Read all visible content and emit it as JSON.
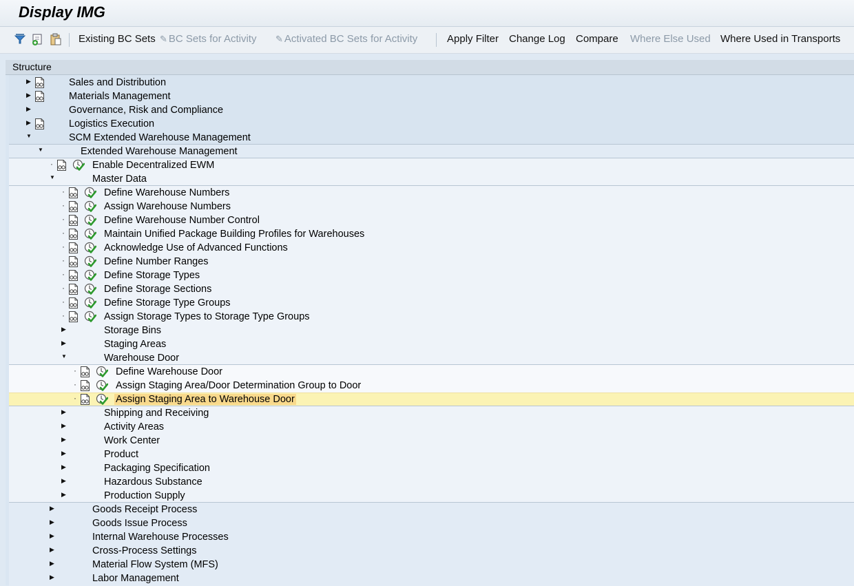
{
  "window": {
    "title": "Display IMG"
  },
  "toolbar": {
    "icons": [
      "filter-icon",
      "add-icon",
      "paste-icon"
    ],
    "buttons": [
      {
        "label": "Existing BC Sets",
        "enabled": true
      },
      {
        "label": "BC Sets for Activity",
        "enabled": false,
        "icon": "bc-set-icon"
      },
      {
        "label": "Activated BC Sets for Activity",
        "enabled": false,
        "icon": "bc-set-icon"
      },
      {
        "label": "Apply Filter",
        "enabled": true
      },
      {
        "label": "Change Log",
        "enabled": true
      },
      {
        "label": "Compare",
        "enabled": true
      },
      {
        "label": "Where Else Used",
        "enabled": false
      },
      {
        "label": "Where Used in Transports",
        "enabled": true
      }
    ]
  },
  "tree": {
    "header": "Structure",
    "selected_item": "Assign Staging Area to Warehouse Door",
    "rows": [
      {
        "label": "Sales and Distribution",
        "level": 1,
        "state": "collapsed",
        "doc": true,
        "exec": false
      },
      {
        "label": "Materials Management",
        "level": 1,
        "state": "collapsed",
        "doc": true,
        "exec": false
      },
      {
        "label": "Governance, Risk and Compliance",
        "level": 1,
        "state": "collapsed",
        "doc": false,
        "exec": false
      },
      {
        "label": "Logistics Execution",
        "level": 1,
        "state": "collapsed",
        "doc": true,
        "exec": false
      },
      {
        "label": "SCM Extended Warehouse Management",
        "level": 1,
        "state": "expanded",
        "doc": false,
        "exec": false
      },
      {
        "label": "Extended Warehouse Management",
        "level": 2,
        "state": "expanded",
        "doc": false,
        "exec": false
      },
      {
        "label": "Enable Decentralized EWM",
        "level": 3,
        "state": "leaf",
        "doc": true,
        "exec": true
      },
      {
        "label": "Master Data",
        "level": 3,
        "state": "expanded",
        "doc": false,
        "exec": false
      },
      {
        "label": "Define Warehouse Numbers",
        "level": 4,
        "state": "leaf",
        "doc": true,
        "exec": true
      },
      {
        "label": "Assign Warehouse Numbers",
        "level": 4,
        "state": "leaf",
        "doc": true,
        "exec": true
      },
      {
        "label": "Define Warehouse Number Control",
        "level": 4,
        "state": "leaf",
        "doc": true,
        "exec": true
      },
      {
        "label": "Maintain Unified Package Building Profiles for Warehouses",
        "level": 4,
        "state": "leaf",
        "doc": true,
        "exec": true
      },
      {
        "label": "Acknowledge Use of Advanced Functions",
        "level": 4,
        "state": "leaf",
        "doc": true,
        "exec": true
      },
      {
        "label": "Define Number Ranges",
        "level": 4,
        "state": "leaf",
        "doc": true,
        "exec": true
      },
      {
        "label": "Define Storage Types",
        "level": 4,
        "state": "leaf",
        "doc": true,
        "exec": true
      },
      {
        "label": "Define Storage Sections",
        "level": 4,
        "state": "leaf",
        "doc": true,
        "exec": true
      },
      {
        "label": "Define Storage Type Groups",
        "level": 4,
        "state": "leaf",
        "doc": true,
        "exec": true
      },
      {
        "label": "Assign Storage Types to Storage Type Groups",
        "level": 4,
        "state": "leaf",
        "doc": true,
        "exec": true
      },
      {
        "label": "Storage Bins",
        "level": 4,
        "state": "collapsed",
        "doc": false,
        "exec": false
      },
      {
        "label": "Staging Areas",
        "level": 4,
        "state": "collapsed",
        "doc": false,
        "exec": false
      },
      {
        "label": "Warehouse Door",
        "level": 4,
        "state": "expanded",
        "doc": false,
        "exec": false
      },
      {
        "label": "Define Warehouse Door",
        "level": 5,
        "state": "leaf",
        "doc": true,
        "exec": true
      },
      {
        "label": "Assign Staging Area/Door Determination Group to Door",
        "level": 5,
        "state": "leaf",
        "doc": true,
        "exec": true
      },
      {
        "label": "Assign Staging Area to Warehouse Door",
        "level": 5,
        "state": "leaf",
        "doc": true,
        "exec": true,
        "selected": true
      },
      {
        "label": "Shipping and Receiving",
        "level": 4,
        "state": "collapsed",
        "doc": false,
        "exec": false
      },
      {
        "label": "Activity Areas",
        "level": 4,
        "state": "collapsed",
        "doc": false,
        "exec": false
      },
      {
        "label": "Work Center",
        "level": 4,
        "state": "collapsed",
        "doc": false,
        "exec": false
      },
      {
        "label": "Product",
        "level": 4,
        "state": "collapsed",
        "doc": false,
        "exec": false
      },
      {
        "label": "Packaging Specification",
        "level": 4,
        "state": "collapsed",
        "doc": false,
        "exec": false
      },
      {
        "label": "Hazardous Substance",
        "level": 4,
        "state": "collapsed",
        "doc": false,
        "exec": false
      },
      {
        "label": "Production Supply",
        "level": 4,
        "state": "collapsed",
        "doc": false,
        "exec": false
      },
      {
        "label": "Goods Receipt Process",
        "level": 3,
        "state": "collapsed",
        "doc": false,
        "exec": false
      },
      {
        "label": "Goods Issue Process",
        "level": 3,
        "state": "collapsed",
        "doc": false,
        "exec": false
      },
      {
        "label": "Internal Warehouse Processes",
        "level": 3,
        "state": "collapsed",
        "doc": false,
        "exec": false
      },
      {
        "label": "Cross-Process Settings",
        "level": 3,
        "state": "collapsed",
        "doc": false,
        "exec": false
      },
      {
        "label": "Material Flow System (MFS)",
        "level": 3,
        "state": "collapsed",
        "doc": false,
        "exec": false
      },
      {
        "label": "Labor Management",
        "level": 3,
        "state": "collapsed",
        "doc": false,
        "exec": false
      }
    ]
  }
}
